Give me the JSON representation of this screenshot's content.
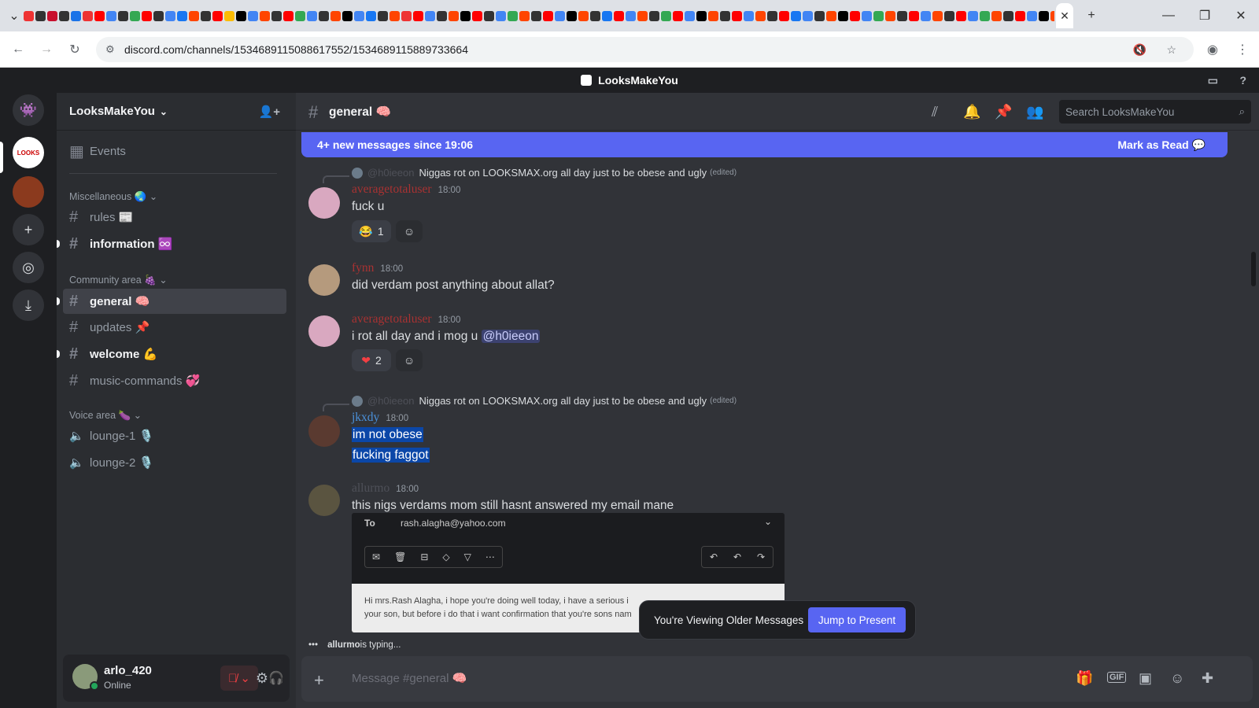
{
  "browser": {
    "url": "discord.com/channels/1534689115088617552/1534689115889733664",
    "favicon_colors": [
      "#e33",
      "#333",
      "#c8102e",
      "#333",
      "#1a73e8",
      "#e33",
      "#ff0000",
      "#4285f4",
      "#333",
      "#34a853",
      "#ff0000",
      "#333",
      "#4285f4",
      "#1877f2",
      "#ff4500",
      "#333",
      "#ff0000",
      "#fbbc05",
      "#000",
      "#4285f4",
      "#ff4500",
      "#333",
      "#ff0000",
      "#34a853",
      "#4285f4",
      "#333",
      "#ff4500",
      "#000",
      "#4285f4",
      "#1877f2",
      "#333",
      "#ff4500",
      "#e33",
      "#ff0000",
      "#4285f4",
      "#333",
      "#ff4500",
      "#000",
      "#ff0000",
      "#333",
      "#4285f4",
      "#34a853",
      "#ff4500",
      "#333",
      "#ff0000",
      "#4285f4",
      "#000",
      "#ff4500",
      "#333",
      "#1877f2",
      "#ff0000",
      "#4285f4",
      "#ff4500",
      "#333",
      "#34a853",
      "#ff0000",
      "#4285f4",
      "#000",
      "#ff4500",
      "#333",
      "#ff0000",
      "#4285f4",
      "#ff4500",
      "#333",
      "#ff0000",
      "#1877f2",
      "#4285f4",
      "#333",
      "#ff4500",
      "#000",
      "#ff0000",
      "#4285f4",
      "#34a853",
      "#ff4500",
      "#333",
      "#ff0000",
      "#4285f4",
      "#ff4500",
      "#333",
      "#ff0000",
      "#4285f4",
      "#34a853",
      "#ff4500",
      "#333",
      "#ff0000",
      "#4285f4",
      "#000",
      "#ff4500",
      "#333",
      "#4caf50"
    ]
  },
  "app": {
    "server_name": "LooksMakeYou",
    "title": "LooksMakeYou"
  },
  "sidebar": {
    "events_label": "Events",
    "categories": [
      {
        "label": "Miscellaneous 🌏"
      },
      {
        "label": "Community area 🍇"
      },
      {
        "label": "Voice area 🍆"
      }
    ],
    "channels": [
      {
        "label": "rules 📰"
      },
      {
        "label": "information ♾️"
      },
      {
        "label": "general 🧠"
      },
      {
        "label": "updates 📌"
      },
      {
        "label": "welcome 💪"
      },
      {
        "label": "music-commands 💞"
      },
      {
        "label": "lounge-1 🎙️"
      },
      {
        "label": "lounge-2 🎙️"
      }
    ]
  },
  "user": {
    "name": "arlo_420",
    "status": "Online"
  },
  "header": {
    "channel": "general 🧠",
    "search_placeholder": "Search LooksMakeYou"
  },
  "banner": {
    "text": "4+ new messages since 19:06",
    "action": "Mark as Read"
  },
  "messages": [
    {
      "reply_user": "@h0ieeon",
      "reply_text": "Niggas rot on LOOKSMAX.org all day just to be obese and ugly",
      "reply_edited": "(edited)",
      "user": "averagetotaluser",
      "time": "18:00",
      "text": "fuck u",
      "reaction_count": "1"
    },
    {
      "user": "fynn",
      "time": "18:00",
      "text": "did verdam post anything about allat?"
    },
    {
      "user": "averagetotaluser",
      "time": "18:00",
      "text": "i rot all day and i mog u",
      "mention": "@h0ieeon",
      "reaction_count": "2"
    },
    {
      "reply_user": "@h0ieeon",
      "reply_text": "Niggas rot on LOOKSMAX.org all day just to be obese and ugly",
      "reply_edited": "(edited)",
      "user": "jkxdy",
      "time": "18:00",
      "lines": [
        "im not obese",
        "fucking faggot"
      ]
    },
    {
      "user": "allurmo",
      "time": "18:00",
      "text": "this nigs verdams mom still hasnt answered my email mane"
    }
  ],
  "embed": {
    "to_label": "To",
    "to_value": "rash.alagha@yahoo.com",
    "body_line1": "Hi mrs.Rash Alagha, i hope you're doing well today, i have a serious i",
    "body_line2": "your son, but before i do that i want confirmation that you're sons nam"
  },
  "typing": {
    "user": "allurmo",
    "suffix": " is typing..."
  },
  "older": {
    "text": "You're Viewing Older Messages",
    "button": "Jump to Present"
  },
  "composer": {
    "placeholder": "Message #general 🧠"
  },
  "colors": {
    "blurple": "#5865f2",
    "username_red": "#ed2a2a",
    "username_red_dim": "#a83232",
    "username_blue": "#4a90d9",
    "username_gray": "#4e5058"
  }
}
